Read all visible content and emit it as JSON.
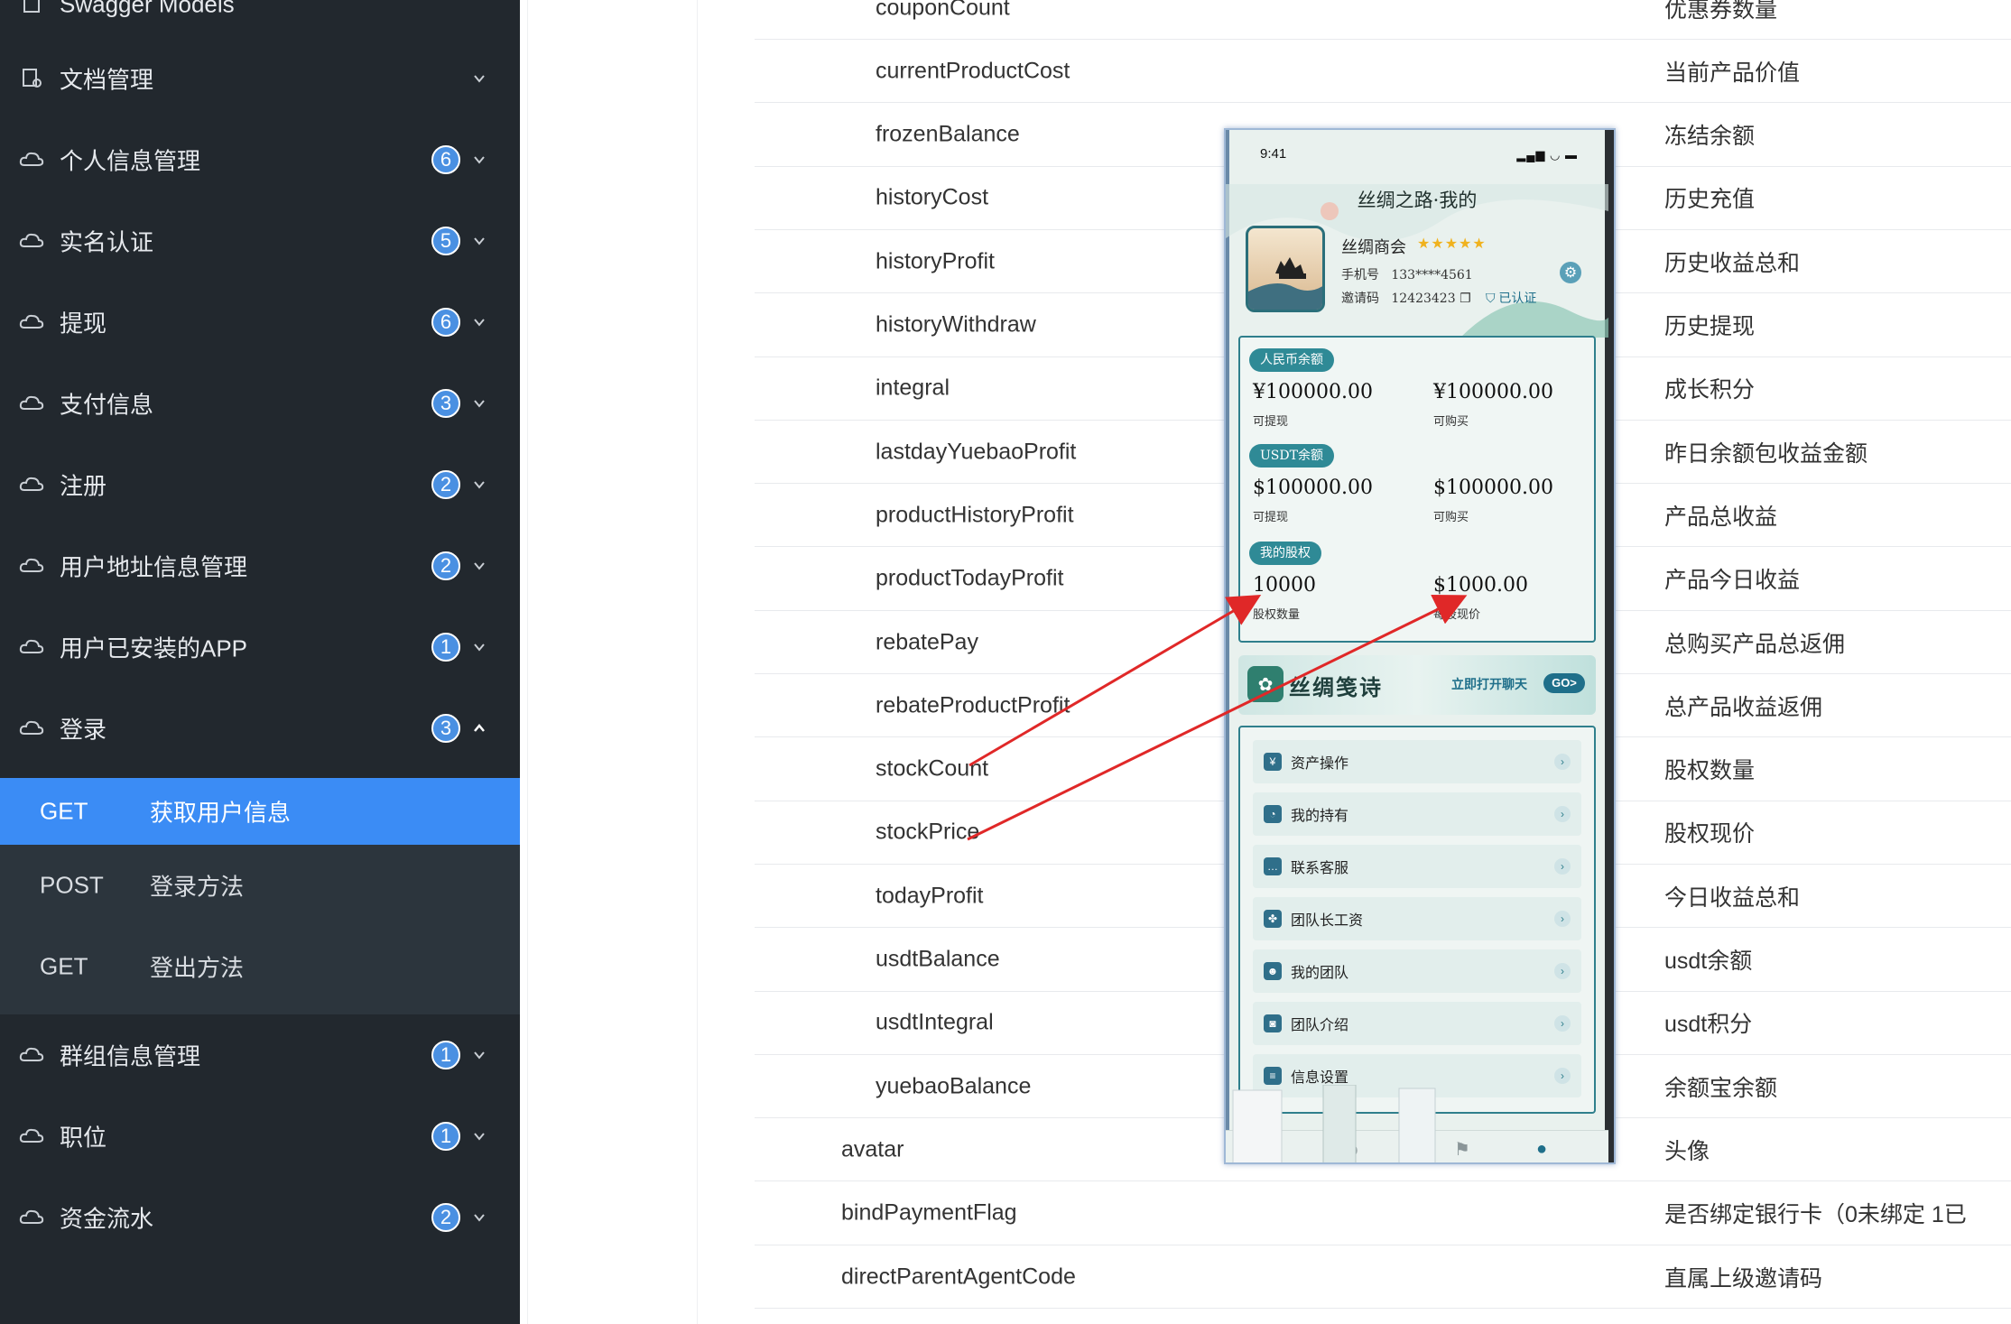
{
  "sidebar": {
    "top_partial_label": "Swagger Models",
    "items": [
      {
        "label": "文档管理",
        "badge": ""
      },
      {
        "label": "个人信息管理",
        "badge": "6"
      },
      {
        "label": "实名认证",
        "badge": "5"
      },
      {
        "label": "提现",
        "badge": "6"
      },
      {
        "label": "支付信息",
        "badge": "3"
      },
      {
        "label": "注册",
        "badge": "2"
      },
      {
        "label": "用户地址信息管理",
        "badge": "2"
      },
      {
        "label": "用户已安装的APP",
        "badge": "1"
      },
      {
        "label": "登录",
        "badge": "3"
      },
      {
        "label": "群组信息管理",
        "badge": "1"
      },
      {
        "label": "职位",
        "badge": "1"
      },
      {
        "label": "资金流水",
        "badge": "2"
      }
    ],
    "sub_items": [
      {
        "method": "GET",
        "label": "获取用户信息"
      },
      {
        "method": "POST",
        "label": "登录方法"
      },
      {
        "method": "GET",
        "label": "登出方法"
      }
    ]
  },
  "fields": [
    {
      "name": "couponCount",
      "desc": "优惠券数量"
    },
    {
      "name": "currentProductCost",
      "desc": "当前产品价值"
    },
    {
      "name": "frozenBalance",
      "desc": "冻结余额"
    },
    {
      "name": "historyCost",
      "desc": "历史充值"
    },
    {
      "name": "historyProfit",
      "desc": "历史收益总和"
    },
    {
      "name": "historyWithdraw",
      "desc": "历史提现"
    },
    {
      "name": "integral",
      "desc": "成长积分"
    },
    {
      "name": "lastdayYuebaoProfit",
      "desc": "昨日余额包收益金额"
    },
    {
      "name": "productHistoryProfit",
      "desc": "产品总收益"
    },
    {
      "name": "productTodayProfit",
      "desc": "产品今日收益"
    },
    {
      "name": "rebatePay",
      "desc": "总购买产品总返佣"
    },
    {
      "name": "rebateProductProfit",
      "desc": "总产品收益返佣"
    },
    {
      "name": "stockCount",
      "desc": "股权数量"
    },
    {
      "name": "stockPrice",
      "desc": "股权现价"
    },
    {
      "name": "todayProfit",
      "desc": "今日收益总和"
    },
    {
      "name": "usdtBalance",
      "desc": "usdt余额"
    },
    {
      "name": "usdtIntegral",
      "desc": "usdt积分"
    },
    {
      "name": "yuebaoBalance",
      "desc": "余额宝余额"
    },
    {
      "name": "avatar",
      "desc": "头像"
    },
    {
      "name": "bindPaymentFlag",
      "desc": "是否绑定银行卡（0未绑定 1已"
    },
    {
      "name": "directParentAgentCode",
      "desc": "直属上级邀请码"
    }
  ],
  "phone": {
    "time": "9:41",
    "title": "丝绸之路·我的",
    "user_name": "丝绸商会",
    "stars": "★★★★★",
    "phone_label": "手机号",
    "phone_value": "133****4561",
    "code_label": "邀请码",
    "code_value": "12423423",
    "verified": "已认证",
    "rmb_tag": "人民币余额",
    "rmb_withdrawable": "¥100000.00",
    "rmb_withdrawable_label": "可提现",
    "rmb_buyable": "¥100000.00",
    "rmb_buyable_label": "可购买",
    "usdt_tag": "USDT余额",
    "usdt_withdrawable": "$100000.00",
    "usdt_withdrawable_label": "可提现",
    "usdt_buyable": "$100000.00",
    "usdt_buyable_label": "可购买",
    "stock_tag": "我的股权",
    "stock_count": "10000",
    "stock_count_label": "股权数量",
    "stock_price": "$1000.00",
    "stock_price_label": "每股现价",
    "banner_title": "丝绸笺诗",
    "banner_cta": "立即打开聊天",
    "banner_go": "GO>",
    "menu": [
      {
        "label": "资产操作",
        "icon": "wallet-icon"
      },
      {
        "label": "我的持有",
        "icon": "pie-icon"
      },
      {
        "label": "联系客服",
        "icon": "chat-icon"
      },
      {
        "label": "团队长工资",
        "icon": "team-icon"
      },
      {
        "label": "我的团队",
        "icon": "group-icon"
      },
      {
        "label": "团队介绍",
        "icon": "intro-icon"
      },
      {
        "label": "信息设置",
        "icon": "settings-icon"
      }
    ]
  },
  "colors": {
    "sidebar_bg": "#22282e",
    "active_bg": "#3b8cf5",
    "badge": "#4a90e2",
    "annotation_arrow": "#e02828",
    "phone_teal": "#2f7f8c"
  }
}
